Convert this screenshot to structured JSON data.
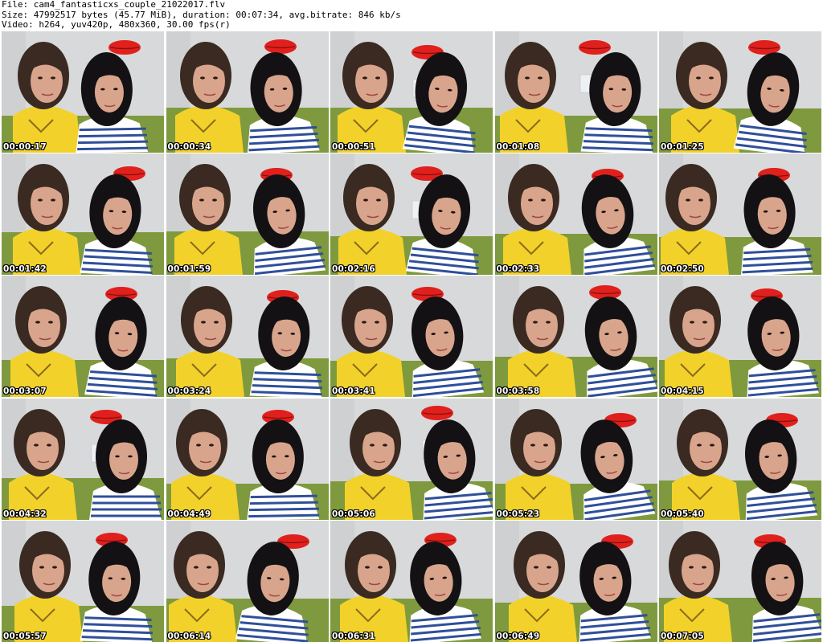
{
  "header": {
    "file_line": "File: cam4_fantasticxs_couple_21022017.flv",
    "size_line": "Size: 47992517 bytes (45.77 MiB), duration: 00:07:34, avg.bitrate: 846 kb/s",
    "video_line": "Video: h264, yuv420p, 480x360, 30.00 fps(r)"
  },
  "colors": {
    "wall": "#d8d9da",
    "couch": "#7f9a3e",
    "lips": "#e0201c",
    "shirt_yellow": "#f2d22a",
    "hair_brown": "#3a2a22",
    "hair_black": "#141114",
    "skin": "#d8a58c",
    "stripes_blue": "#2f4f9a"
  },
  "thumbnails": [
    {
      "timestamp": "00:00:17"
    },
    {
      "timestamp": "00:00:34"
    },
    {
      "timestamp": "00:00:51"
    },
    {
      "timestamp": "00:01:08"
    },
    {
      "timestamp": "00:01:25"
    },
    {
      "timestamp": "00:01:42"
    },
    {
      "timestamp": "00:01:59"
    },
    {
      "timestamp": "00:02:16"
    },
    {
      "timestamp": "00:02:33"
    },
    {
      "timestamp": "00:02:50"
    },
    {
      "timestamp": "00:03:07"
    },
    {
      "timestamp": "00:03:24"
    },
    {
      "timestamp": "00:03:41"
    },
    {
      "timestamp": "00:03:58"
    },
    {
      "timestamp": "00:04:15"
    },
    {
      "timestamp": "00:04:32"
    },
    {
      "timestamp": "00:04:49"
    },
    {
      "timestamp": "00:05:06"
    },
    {
      "timestamp": "00:05:23"
    },
    {
      "timestamp": "00:05:40"
    },
    {
      "timestamp": "00:05:57"
    },
    {
      "timestamp": "00:06:14"
    },
    {
      "timestamp": "00:06:31"
    },
    {
      "timestamp": "00:06:49"
    },
    {
      "timestamp": "00:07:05"
    }
  ]
}
